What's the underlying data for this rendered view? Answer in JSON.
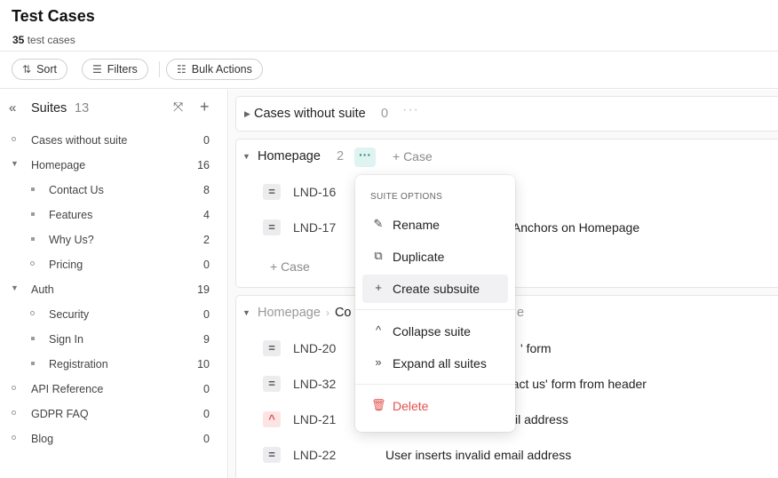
{
  "header": {
    "title": "Test Cases",
    "count_number": "35",
    "count_suffix": "test cases"
  },
  "toolbar": {
    "sort_label": "Sort",
    "filters_label": "Filters",
    "bulk_label": "Bulk Actions"
  },
  "sidebar": {
    "title": "Suites",
    "count": "13",
    "items": [
      {
        "label": "Cases without suite",
        "count": "0"
      },
      {
        "label": "Homepage",
        "count": "16"
      },
      {
        "label": "Contact Us",
        "count": "8"
      },
      {
        "label": "Features",
        "count": "4"
      },
      {
        "label": "Why Us?",
        "count": "2"
      },
      {
        "label": "Pricing",
        "count": "0"
      },
      {
        "label": "Auth",
        "count": "19"
      },
      {
        "label": "Security",
        "count": "0"
      },
      {
        "label": "Sign In",
        "count": "9"
      },
      {
        "label": "Registration",
        "count": "10"
      },
      {
        "label": "API Reference",
        "count": "0"
      },
      {
        "label": "GDPR FAQ",
        "count": "0"
      },
      {
        "label": "Blog",
        "count": "0"
      }
    ]
  },
  "main": {
    "no_suite": {
      "name": "Cases without suite",
      "count": "0"
    },
    "homepage": {
      "name": "Homepage",
      "count": "2",
      "add_case": "+ Case",
      "cases": [
        {
          "id": "LND-16",
          "title": ""
        },
        {
          "id": "LND-17",
          "title": "h Anchors on Homepage"
        }
      ],
      "add_case_footer": "+ Case"
    },
    "contact": {
      "breadcrumb_parent": "Homepage",
      "breadcrumb_child": "Co",
      "trailing": "e",
      "cases": [
        {
          "id": "LND-20",
          "title": "' form",
          "priority": "normal"
        },
        {
          "id": "LND-32",
          "title": "ntact us' form from header",
          "priority": "normal"
        },
        {
          "id": "LND-21",
          "title": "il address",
          "priority": "high"
        },
        {
          "id": "LND-22",
          "title": "User inserts invalid email address",
          "priority": "normal"
        }
      ]
    }
  },
  "dropdown": {
    "heading": "SUITE OPTIONS",
    "items": [
      {
        "label": "Rename",
        "icon": "pencil-icon"
      },
      {
        "label": "Duplicate",
        "icon": "copy-icon"
      },
      {
        "label": "Create subsuite",
        "icon": "plus-icon"
      },
      {
        "label": "Collapse suite",
        "icon": "chevron-up-icon"
      },
      {
        "label": "Expand all suites",
        "icon": "double-chevron-down-icon"
      },
      {
        "label": "Delete",
        "icon": "trash-icon"
      }
    ],
    "danger_color": "#e0524c"
  }
}
